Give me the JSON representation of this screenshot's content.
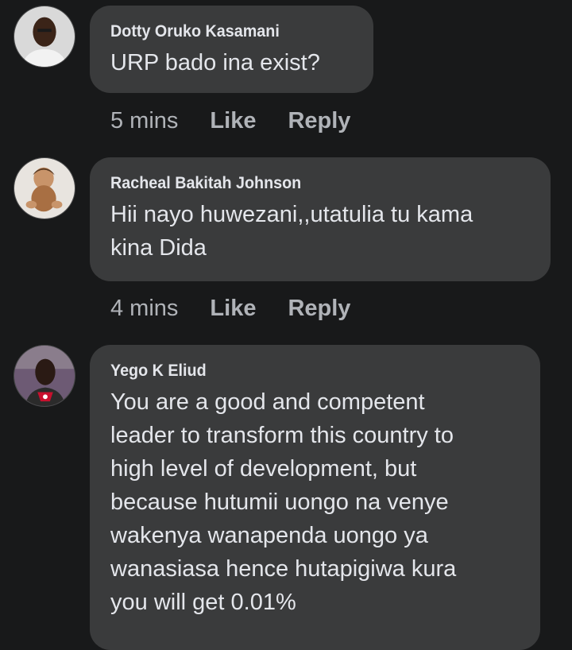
{
  "comments": [
    {
      "author": "Dotty Oruko Kasamani",
      "text": "URP bado ina exist?",
      "time": "5 mins",
      "like_label": "Like",
      "reply_label": "Reply",
      "avatar_icon": "profile-photo"
    },
    {
      "author": "Racheal Bakitah Johnson",
      "text": "Hii nayo huwezani,,utatulia tu kama\nkina Dida",
      "time": "4 mins",
      "like_label": "Like",
      "reply_label": "Reply",
      "avatar_icon": "profile-photo"
    },
    {
      "author": "Yego K Eliud",
      "text": "You are a good and competent\nleader to transform this country to\nhigh level of development, but\nbecause hutumii uongo na venye\nwakenya wanapenda uongo ya\nwanasiasa hence hutapigiwa kura\nyou will get 0.01%",
      "avatar_icon": "profile-photo"
    }
  ],
  "colors": {
    "background": "#18191a",
    "bubble": "#3a3b3c",
    "text": "#e4e6eb",
    "secondary_text": "#b0b3b8"
  }
}
